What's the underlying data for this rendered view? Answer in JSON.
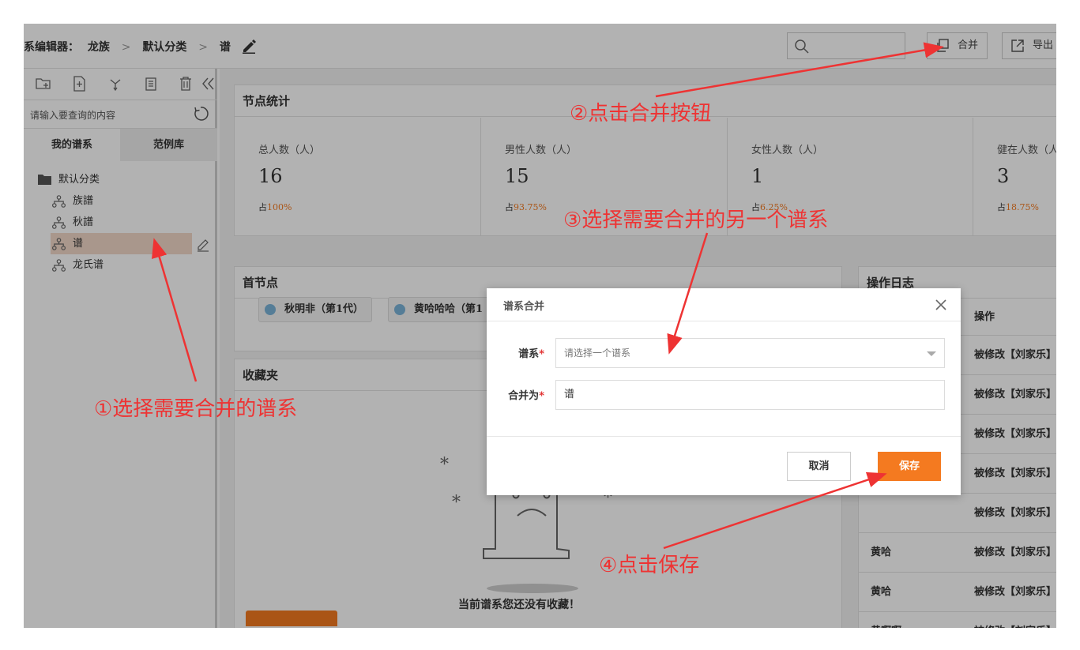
{
  "header": {
    "breadcrumb_root": "谱系编辑器：",
    "breadcrumb_1": "龙族",
    "breadcrumb_2": "默认分类",
    "breadcrumb_3": "谱",
    "separator": ">",
    "merge_label": "合并",
    "export_label": "导出"
  },
  "sidebar": {
    "search_placeholder": "请输入要查询的内容",
    "tabs": [
      "我的谱系",
      "范例库"
    ],
    "folder_label": "默认分类",
    "items": [
      {
        "label": "族譜"
      },
      {
        "label": "秋譜"
      },
      {
        "label": "谱"
      },
      {
        "label": "龙氏谱"
      }
    ]
  },
  "stats": {
    "title": "节点统计",
    "cards": [
      {
        "label": "总人数（人）",
        "value": "16",
        "pct_prefix": "占",
        "pct": "100%"
      },
      {
        "label": "男性人数（人）",
        "value": "15",
        "pct_prefix": "占",
        "pct": "93.75%"
      },
      {
        "label": "女性人数（人）",
        "value": "1",
        "pct_prefix": "占",
        "pct": "6.25%"
      },
      {
        "label": "健在人数（人）",
        "value": "3",
        "pct_prefix": "占",
        "pct": "18.75%"
      }
    ]
  },
  "root_nodes": {
    "title": "首节点",
    "chips": [
      "秋明非（第1代）",
      "黄哈哈哈（第1"
    ]
  },
  "favorites": {
    "title": "收藏夹",
    "empty_text": "当前谱系您还没有收藏！"
  },
  "log": {
    "title": "操作日志",
    "col_action": "操作",
    "rows": [
      {
        "name": "",
        "action": "被修改【刘家乐】"
      },
      {
        "name": "",
        "action": "被修改【刘家乐】"
      },
      {
        "name": "",
        "action": "被修改【刘家乐】"
      },
      {
        "name": "",
        "action": "被修改【刘家乐】"
      },
      {
        "name": "",
        "action": "被修改【刘家乐】"
      },
      {
        "name": "黄哈",
        "action": "被修改【刘家乐】"
      },
      {
        "name": "黄哈",
        "action": "被修改【刘家乐】"
      },
      {
        "name": "黄啊啊",
        "action": "被修改【刘家乐】"
      }
    ]
  },
  "modal": {
    "title": "谱系合并",
    "field1_label": "谱系",
    "field1_placeholder": "请选择一个谱系",
    "field2_label": "合并为",
    "field2_value": "谱",
    "required_mark": "*",
    "cancel_label": "取消",
    "save_label": "保存"
  },
  "annotations": {
    "step1": "①选择需要合并的谱系",
    "step2": "②点击合并按钮",
    "step3": "③选择需要合并的另一个谱系",
    "step4": "④点击保存",
    "color": "#ee3333"
  },
  "colors": {
    "accent": "#f47a20",
    "selected_row": "#f3d9c9"
  }
}
